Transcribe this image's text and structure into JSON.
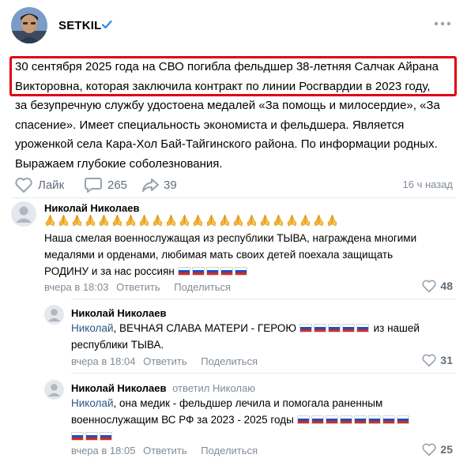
{
  "post": {
    "author": "SETKIL",
    "text_lines": [
      "30 сентября 2025 года на СВО погибла фельдшер 38-летняя Салчак Айрана",
      "Викторовна, которая заключила контракт по линии Росгвардии в 2023 году,",
      "за безупречную службу удостоена медалей «За помощь и милосердие», «За",
      "спасение». Имеет специальность экономиста и фельдшера. Является",
      "уроженкой села Кара-Хол Бай-Тайгинского района. По информации родных.",
      "Выражаем глубокие соболезнования."
    ],
    "like_label": "Лайк",
    "comment_count": "265",
    "share_count": "39",
    "time": "16 ч назад"
  },
  "comments": [
    {
      "author": "Николай Николаев",
      "pray_count": 22,
      "line1": "Наша смелая военнослужащая из республики ТЫВА, награждена многими",
      "line2": "медалями и орденами, любимая мать своих детей поехала защищать",
      "line3": "РОДИНУ и за нас россиян",
      "flags_line3": 5,
      "time": "вчера в 18:03",
      "reply": "Ответить",
      "share": "Поделиться",
      "likes": "48"
    },
    {
      "author": "Николай Николаев",
      "mention": "Николай",
      "line1": ", ВЕЧНАЯ СЛАВА МАТЕРИ - ГЕРОЮ",
      "flags_line1": 5,
      "line1_end": "из нашей",
      "line2": "республики ТЫВА.",
      "time": "вчера в 18:04",
      "reply": "Ответить",
      "share": "Поделиться",
      "likes": "31"
    },
    {
      "author": "Николай Николаев",
      "answered": "ответил Николаю",
      "mention": "Николай",
      "line1": ", она медик - фельдшер лечила и помогала раненным",
      "line2": "военнослужащим ВС РФ за 2023 - 2025 годы",
      "flags_line2": 8,
      "flags_line3": 3,
      "time": "вчера в 18:05",
      "reply": "Ответить",
      "share": "Поделиться",
      "likes": "25"
    }
  ],
  "colors": {
    "highlight_border": "#e10012",
    "verified": "#2688eb",
    "action_gray": "#99a2ad",
    "mention_blue": "#2a5885"
  },
  "icons": [
    "avatar-photo",
    "verified-check-icon",
    "more-dots-icon",
    "heart-icon",
    "comment-icon",
    "share-arrow-icon",
    "praying-hands-emoji",
    "russia-flag-emoji"
  ]
}
